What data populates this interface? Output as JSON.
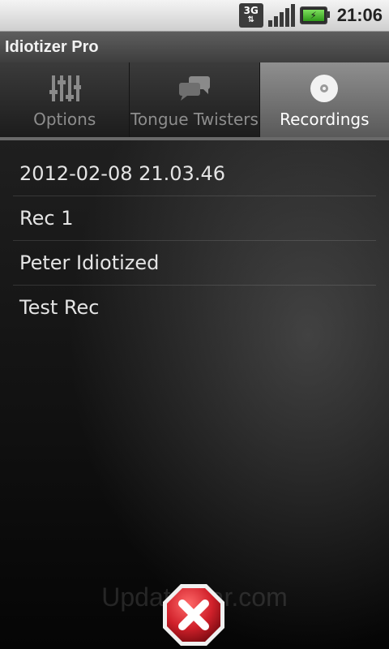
{
  "status_bar": {
    "network": "3G",
    "time": "21:06"
  },
  "app": {
    "title": "Idiotizer Pro"
  },
  "tabs": [
    {
      "label": "Options",
      "icon": "equalizer-icon",
      "active": false
    },
    {
      "label": "Tongue Twisters",
      "icon": "speech-bubbles-icon",
      "active": false
    },
    {
      "label": "Recordings",
      "icon": "disc-icon",
      "active": true
    }
  ],
  "recordings": [
    {
      "name": "2012-02-08 21.03.46"
    },
    {
      "name": "Rec 1"
    },
    {
      "name": "Peter Idiotized"
    },
    {
      "name": "Test Rec"
    }
  ],
  "watermark": "UpdateStar.com",
  "colors": {
    "active_tab_bg": "#7a7a7a",
    "delete_red": "#d0202a"
  }
}
